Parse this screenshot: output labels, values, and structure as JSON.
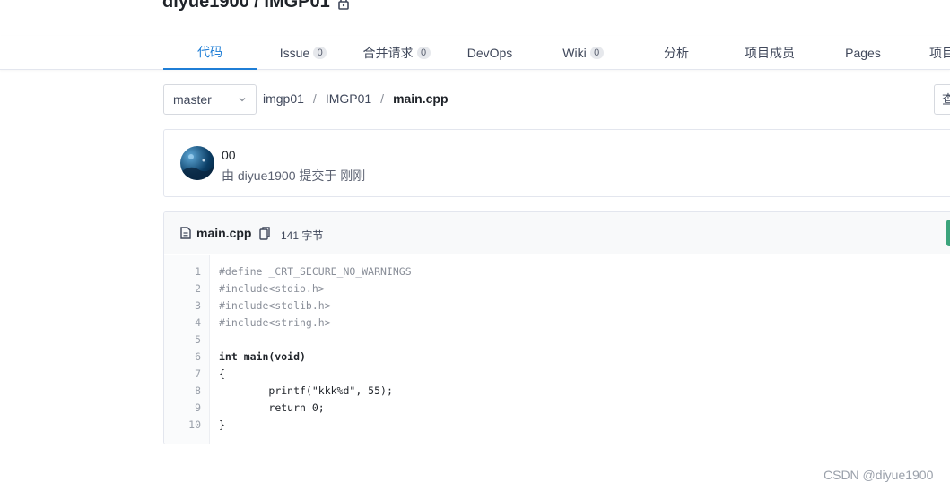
{
  "repo": {
    "owner": "diyue1900",
    "separator": "/",
    "name": "IMGP01",
    "title": "diyue1900 / IMGP01"
  },
  "tabs": [
    {
      "label": "代码",
      "count": null,
      "active": true
    },
    {
      "label": "Issue",
      "count": "0"
    },
    {
      "label": "合并请求",
      "count": "0"
    },
    {
      "label": "DevOps",
      "count": null
    },
    {
      "label": "Wiki",
      "count": "0"
    },
    {
      "label": "分析",
      "count": null
    },
    {
      "label": "项目成员",
      "count": null
    },
    {
      "label": "Pages",
      "count": null
    },
    {
      "label": "项目",
      "count": null
    }
  ],
  "branch": {
    "selected": "master"
  },
  "breadcrumb": {
    "root": "imgp01",
    "folder": "IMGP01",
    "file": "main.cpp",
    "sep": "/"
  },
  "right_button": {
    "label": "查"
  },
  "commit": {
    "message": "00",
    "meta": "由 diyue1900 提交于 刚刚"
  },
  "file": {
    "name": "main.cpp",
    "size": "141 字节"
  },
  "code_lines": [
    "#define _CRT_SECURE_NO_WARNINGS",
    "#include<stdio.h>",
    "#include<stdlib.h>",
    "#include<string.h>",
    "",
    "int main(void)",
    "{",
    "\tprintf(\"kkk%d\", 55);",
    "\treturn 0;",
    "}"
  ],
  "watermark": "CSDN @diyue1900",
  "colors": {
    "accent": "#1f7ed6",
    "green": "#3ca47c",
    "string": "#c4262e",
    "number": "#1b8a8a"
  }
}
